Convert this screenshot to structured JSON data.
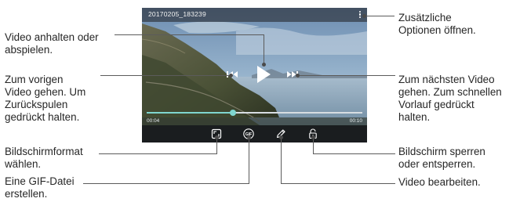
{
  "video": {
    "title": "20170205_183239",
    "current_time": "00:04",
    "total_time": "00:10",
    "progress": 0.4
  },
  "callouts": {
    "options": "Zusätzliche\nOptionen öffnen.",
    "play_pause": "Video anhalten oder\nabspielen.",
    "previous": "Zum vorigen\nVideo gehen. Um\nZurückspulen\ngedrückt halten.",
    "next": "Zum nächsten Video\ngehen. Zum schnellen\nVorlauf gedrückt\nhalten.",
    "screen_ratio": "Bildschirmformat\nwählen.",
    "gif": "Eine GIF-Datei\nerstellen.",
    "lock": "Bildschirm sperren\noder entsperren.",
    "edit": "Video bearbeiten."
  },
  "colors": {
    "progress_fill": "#7fd6cf",
    "progress_track": "#d7dde2",
    "topbar": "#2c3036",
    "bottombar": "#141618",
    "leader_line": "#5b5b5b"
  },
  "icons": {
    "menu": "more-vert-icon",
    "play": "play-icon",
    "previous": "skip-previous-icon",
    "next": "skip-next-icon",
    "screen_ratio": "aspect-ratio-icon",
    "gif": "gif-icon",
    "edit": "pencil-icon",
    "lock": "lock-icon"
  }
}
